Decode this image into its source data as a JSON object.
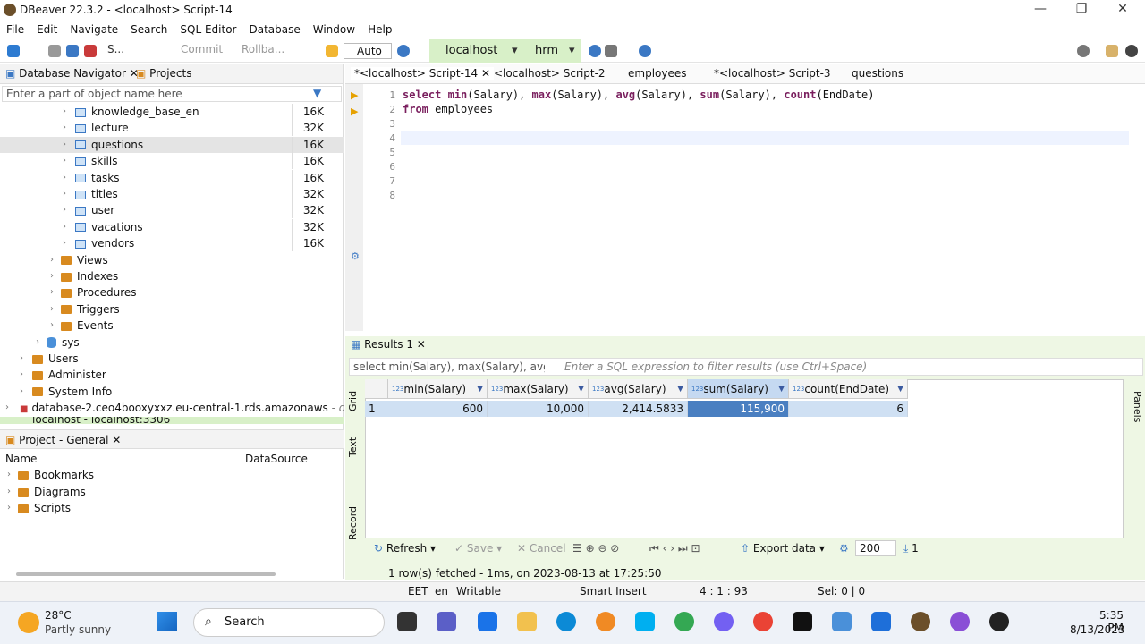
{
  "window": {
    "title": "DBeaver 22.3.2 - <localhost> Script-14"
  },
  "menu": [
    "File",
    "Edit",
    "Navigate",
    "Search",
    "SQL Editor",
    "Database",
    "Window",
    "Help"
  ],
  "toolbar": {
    "s_label": "S...",
    "commit": "Commit",
    "rollback": "Rollba...",
    "auto": "Auto",
    "connection": "localhost",
    "schema": "hrm"
  },
  "navigator": {
    "tab_db": "Database Navigator",
    "tab_projects": "Projects",
    "filter_placeholder": "Enter a part of object name here",
    "tables": [
      {
        "name": "knowledge_base_en",
        "size": "16K"
      },
      {
        "name": "lecture",
        "size": "32K"
      },
      {
        "name": "questions",
        "size": "16K"
      },
      {
        "name": "skills",
        "size": "16K"
      },
      {
        "name": "tasks",
        "size": "16K"
      },
      {
        "name": "titles",
        "size": "32K"
      },
      {
        "name": "user",
        "size": "32K"
      },
      {
        "name": "vacations",
        "size": "32K"
      },
      {
        "name": "vendors",
        "size": "16K"
      }
    ],
    "folders": [
      "Views",
      "Indexes",
      "Procedures",
      "Triggers",
      "Events"
    ],
    "sys": "sys",
    "top_folders": [
      "Users",
      "Administer",
      "System Info"
    ],
    "remote_db": "database-2.ceo4booxyxxz.eu-central-1.rds.amazonaws",
    "remote_db_suffix": "- datab",
    "partial": "localhost - localhost:3306"
  },
  "project": {
    "title": "Project - General",
    "col_name": "Name",
    "col_datasource": "DataSource",
    "items": [
      "Bookmarks",
      "Diagrams",
      "Scripts"
    ]
  },
  "editor": {
    "tabs": [
      "*<localhost> Script-14",
      "<localhost> Script-2",
      "employees",
      "*<localhost> Script-3",
      "questions"
    ],
    "line1_kw": "select",
    "line1_rest": [
      {
        "k": "min",
        "a": "(Salary), "
      },
      {
        "k": "max",
        "a": "(Salary), "
      },
      {
        "k": "avg",
        "a": "(Salary), "
      },
      {
        "k": "sum",
        "a": "(Salary), "
      },
      {
        "k": "count",
        "a": "(EndDate)"
      }
    ],
    "line2_kw": "from",
    "line2_rest": " employees",
    "line_numbers": [
      "1",
      "2",
      "3",
      "4",
      "5",
      "6",
      "7",
      "8"
    ]
  },
  "results": {
    "tab": "Results 1",
    "query_preview": "select min(Salary), max(Salary), avg(Sa",
    "filter_placeholder": "Enter a SQL expression to filter results (use Ctrl+Space)",
    "columns": [
      "min(Salary)",
      "max(Salary)",
      "avg(Salary)",
      "sum(Salary)",
      "count(EndDate)"
    ],
    "row_num": "1",
    "row": [
      "600",
      "10,000",
      "2,414.5833",
      "115,900",
      "6"
    ],
    "vtabs": [
      "Grid",
      "Text",
      "Record"
    ],
    "refresh": "Refresh",
    "save": "Save",
    "cancel": "Cancel",
    "export": "Export data",
    "limit": "200",
    "count": "1",
    "status": "1 row(s) fetched - 1ms, on 2023-08-13 at 17:25:50",
    "panels": "Panels"
  },
  "statusbar": {
    "tz": "EET",
    "lang": "en",
    "mode": "Writable",
    "insert": "Smart Insert",
    "pos": "4 : 1 : 93",
    "sel": "Sel: 0 | 0"
  },
  "taskbar": {
    "temp": "28°C",
    "weather": "Partly sunny",
    "search": "Search",
    "time": "5:35 PM",
    "date": "8/13/2023"
  }
}
